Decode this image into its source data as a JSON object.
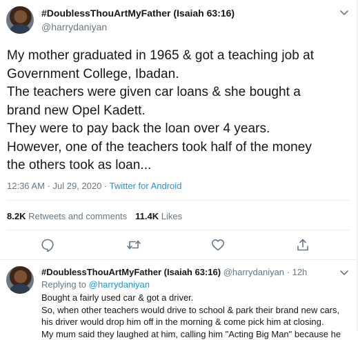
{
  "tweet": {
    "display_name": "#DoublessThouArtMyFather (Isaiah 63:16)",
    "handle": "@harrydaniyan",
    "text_lines": [
      "My mother graduated in 1965 & got a teaching job at",
      "Government College, Ibadan.",
      "The teachers were given car loans & she bought a",
      "brand new Opel Kadett.",
      "They were to pay back the loan over 4 years.",
      "However, one of the teachers took half of the money",
      "the others took as loan..."
    ],
    "timestamp": "12:36 AM · Jul 29, 2020 · ",
    "source": "Twitter for Android",
    "retweets_count": "8.2K",
    "retweets_label": "Retweets and comments",
    "likes_count": "11.4K",
    "likes_label": "Likes"
  },
  "icons": {
    "menu": "chevron-down-icon",
    "reply": "comment-icon",
    "retweet": "retweet-icon",
    "like": "heart-icon",
    "share": "share-icon"
  },
  "reply": {
    "display_name": "#DoublessThouArtMyFather (Isaiah 63:16)",
    "handle_time": "@harrydaniyan · 12h",
    "replying_prefix": "Replying to ",
    "replying_to": "@harrydaniyan",
    "text_lines": [
      "Bought a fairly used car & got a driver.",
      "So, when other teachers would drive to school & park their brand new cars,",
      "his driver would drop him off in the morning & come pick him at closing.",
      "My mum said they laughed at him, calling him \"Acting Big Man\" because he"
    ]
  },
  "colors": {
    "text": "#14171a",
    "secondary": "#657786",
    "link": "#1b95e0",
    "divider": "#e6ecf0"
  }
}
